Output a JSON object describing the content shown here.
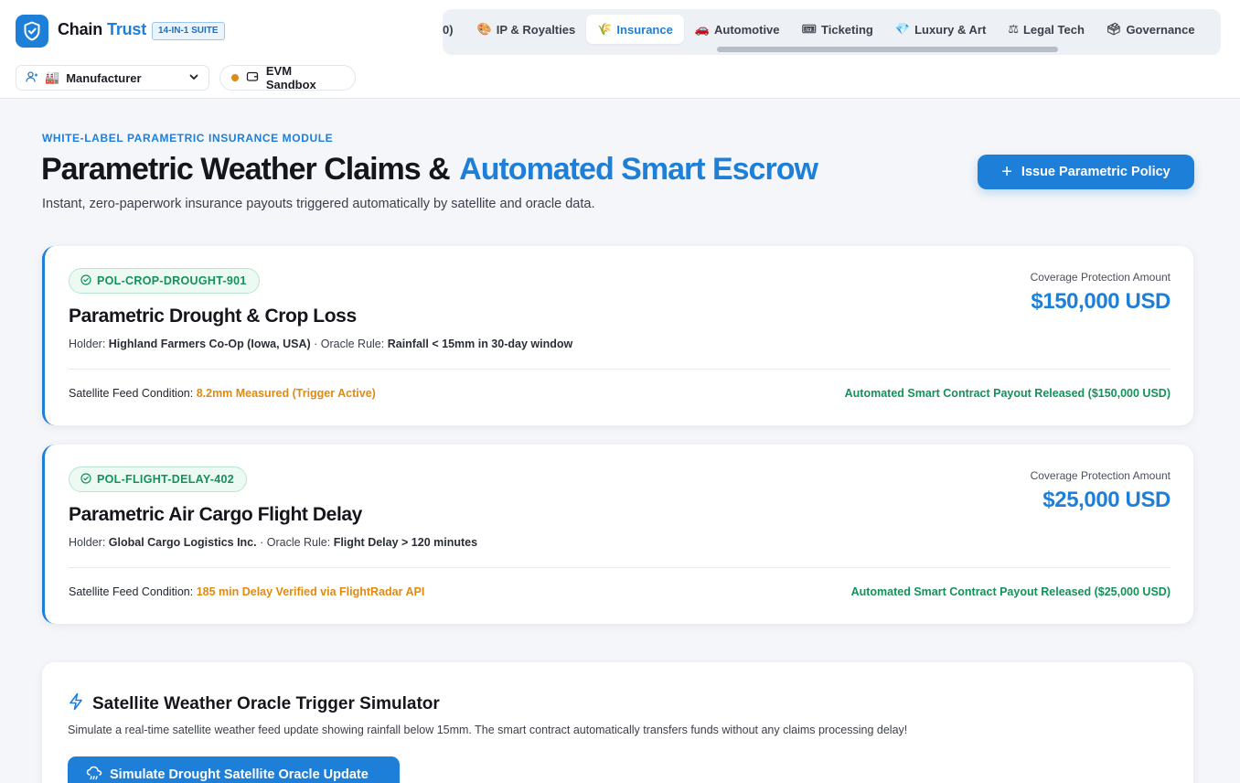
{
  "brand": {
    "name_part1": "Chain",
    "name_part2": "Trust",
    "suite_badge": "14-IN-1 SUITE",
    "accent_color": "#1e7fd9"
  },
  "role_selector": {
    "icon": "user-icon",
    "emoji": "🏭",
    "value": "Manufacturer"
  },
  "network": {
    "label": "EVM Sandbox",
    "status_color": "#e08a17",
    "icon": "wallet-icon"
  },
  "tabs": [
    {
      "label": "0)",
      "icon": "",
      "active": false,
      "partial": true
    },
    {
      "label": "IP & Royalties",
      "icon": "🎨",
      "active": false
    },
    {
      "label": "Insurance",
      "icon": "🌾",
      "active": true
    },
    {
      "label": "Automotive",
      "icon": "🚗",
      "active": false
    },
    {
      "label": "Ticketing",
      "icon": "🎟",
      "active": false
    },
    {
      "label": "Luxury & Art",
      "icon": "💎",
      "active": false
    },
    {
      "label": "Legal Tech",
      "icon": "⚖",
      "active": false
    },
    {
      "label": "Governance",
      "icon": "🗳",
      "active": false
    }
  ],
  "hero": {
    "eyebrow": "WHITE-LABEL PARAMETRIC INSURANCE MODULE",
    "title_main": "Parametric Weather Claims &",
    "title_accent": "Automated Smart Escrow",
    "subtitle": "Instant, zero-paperwork insurance payouts triggered automatically by satellite and oracle data.",
    "action_label": "Issue Parametric Policy"
  },
  "policies": [
    {
      "id": "POL-CROP-DROUGHT-901",
      "name": "Parametric Drought & Crop Loss",
      "holder_label": "Holder:",
      "holder": "Highland Farmers Co-Op (Iowa, USA)",
      "rule_label": "· Oracle Rule:",
      "rule": "Rainfall < 15mm in 30-day window",
      "coverage_label": "Coverage Protection Amount",
      "coverage": "$150,000 USD",
      "feed_label": "Satellite Feed Condition:",
      "feed_value": "8.2mm Measured (Trigger Active)",
      "payout": "Automated Smart Contract Payout Released ($150,000 USD)"
    },
    {
      "id": "POL-FLIGHT-DELAY-402",
      "name": "Parametric Air Cargo Flight Delay",
      "holder_label": "Holder:",
      "holder": "Global Cargo Logistics Inc.",
      "rule_label": "· Oracle Rule:",
      "rule": "Flight Delay > 120 minutes",
      "coverage_label": "Coverage Protection Amount",
      "coverage": "$25,000 USD",
      "feed_label": "Satellite Feed Condition:",
      "feed_value": "185 min Delay Verified via FlightRadar API",
      "payout": "Automated Smart Contract Payout Released ($25,000 USD)"
    }
  ],
  "simulator": {
    "title": "Satellite Weather Oracle Trigger Simulator",
    "description": "Simulate a real-time satellite weather feed update showing rainfall below 15mm. The smart contract automatically transfers funds without any claims processing delay!",
    "button_label": "Simulate Drought Satellite Oracle Update"
  },
  "colors": {
    "success": "#14915a",
    "warning": "#df8a12",
    "primary": "#1e7fd9"
  }
}
